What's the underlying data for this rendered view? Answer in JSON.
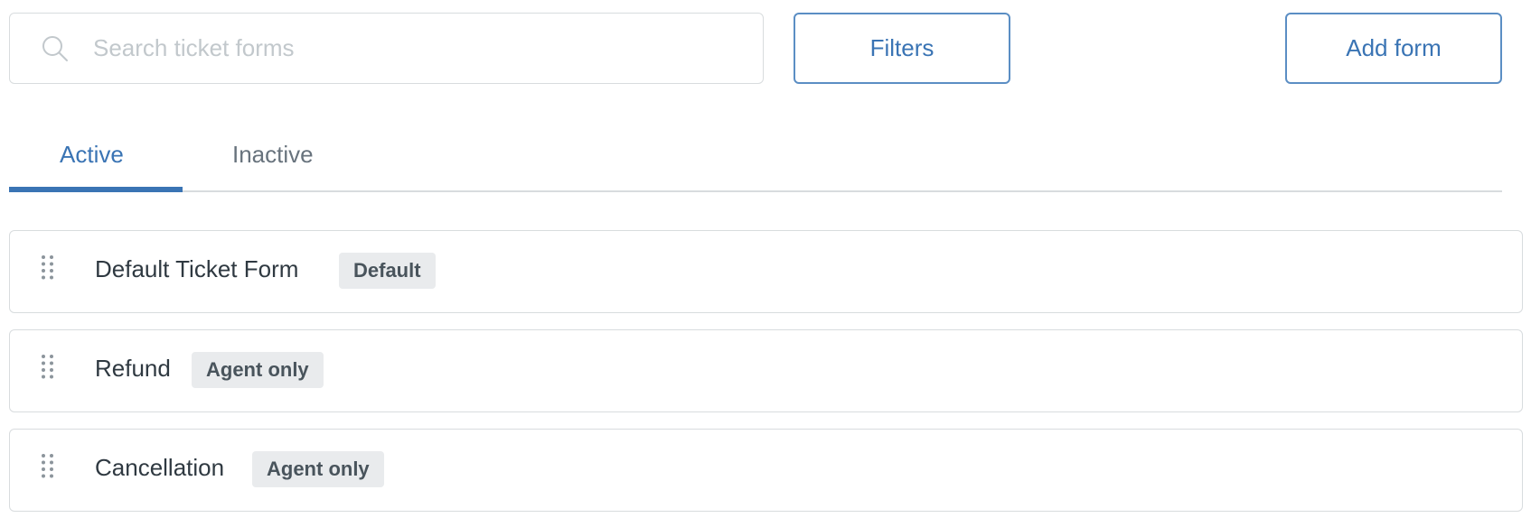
{
  "search": {
    "placeholder": "Search ticket forms",
    "value": "",
    "icon": "search-icon"
  },
  "toolbar": {
    "filters_label": "Filters",
    "add_form_label": "Add form"
  },
  "tabs": [
    {
      "label": "Active",
      "selected": true
    },
    {
      "label": "Inactive",
      "selected": false
    }
  ],
  "forms": [
    {
      "name": "Default Ticket Form",
      "badge": "Default",
      "icon": "drag-handle-icon"
    },
    {
      "name": "Refund",
      "badge": "Agent only",
      "icon": "drag-handle-icon"
    },
    {
      "name": "Cancellation",
      "badge": "Agent only",
      "icon": "drag-handle-icon"
    }
  ],
  "colors": {
    "accent": "#3a74b4",
    "border": "#d8dcde",
    "badge_bg": "#e9ebed",
    "text": "#2f3941",
    "muted": "#68737d"
  }
}
